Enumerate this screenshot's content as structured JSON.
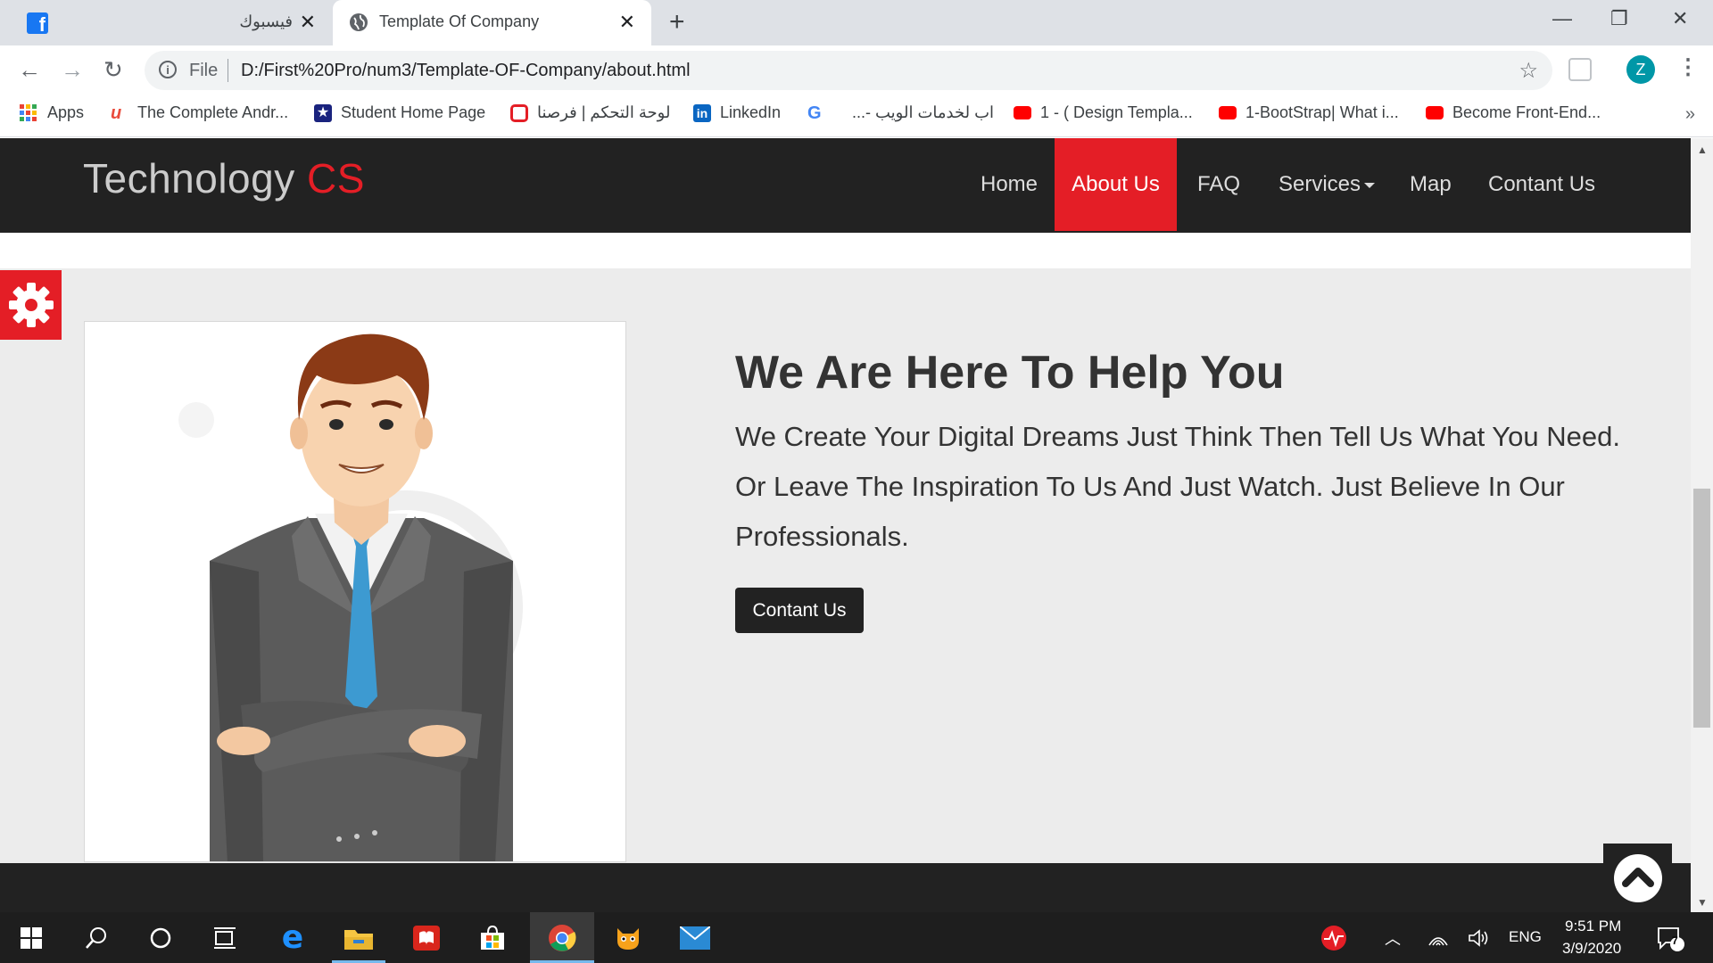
{
  "browser": {
    "tabs": [
      {
        "title": "فيسبوك",
        "active": false
      },
      {
        "title": "Template Of Company",
        "active": true
      }
    ],
    "new_tab_symbol": "+",
    "window_controls": {
      "minimize": "—",
      "restore": "❐",
      "close": "✕"
    },
    "nav": {
      "back": "←",
      "forward": "→",
      "reload": "↻"
    },
    "address": {
      "scheme_label": "File",
      "url": "D:/First%20Pro/num3/Template-OF-Company/about.html"
    },
    "profile_initial": "Z",
    "bookmarks": [
      {
        "label": "Apps",
        "icon": "apps-grid-icon"
      },
      {
        "label": "The Complete Andr...",
        "icon": "udemy-icon"
      },
      {
        "label": "Student Home Page",
        "icon": "star-badge-icon"
      },
      {
        "label": "لوحة التحكم | فرصنا",
        "icon": "forsana-icon"
      },
      {
        "label": "LinkedIn",
        "icon": "linkedin-icon"
      },
      {
        "label": "...- اب لخدمات الويب",
        "icon": "google-icon"
      },
      {
        "label": "1 - ( Design Templa...",
        "icon": "youtube-icon"
      },
      {
        "label": "1-BootStrap| What i...",
        "icon": "youtube-icon"
      },
      {
        "label": "Become Front-End...",
        "icon": "youtube-icon"
      }
    ],
    "bookmarks_overflow": "»"
  },
  "site": {
    "brand": {
      "main": "Technology",
      "accent": "CS"
    },
    "nav": [
      {
        "label": "Home",
        "active": false
      },
      {
        "label": "About Us",
        "active": true
      },
      {
        "label": "FAQ",
        "active": false
      },
      {
        "label": "Services",
        "active": false,
        "dropdown": true
      },
      {
        "label": "Map",
        "active": false
      },
      {
        "label": "Contant Us",
        "active": false
      }
    ],
    "about": {
      "headline": "We Are Here To Help You",
      "paragraph": "We Create Your Digital Dreams Just Think Then Tell Us What You Need. Or Leave The Inspiration To Us And Just Watch. Just Believe In Our Professionals.",
      "cta_label": "Contant Us"
    }
  },
  "taskbar": {
    "apps": [
      "windows-start-icon",
      "search-icon",
      "cortana-icon",
      "task-view-icon",
      "edge-icon",
      "file-explorer-icon",
      "acrobat-icon",
      "store-icon",
      "chrome-icon",
      "scratch-cat-icon",
      "mail-icon"
    ],
    "language": "ENG",
    "time": "9:51 PM",
    "date": "3/9/2020",
    "notification_count": "7"
  },
  "colors": {
    "accent": "#e41e26",
    "nav_bg": "#222222",
    "page_bg": "#ececec"
  }
}
